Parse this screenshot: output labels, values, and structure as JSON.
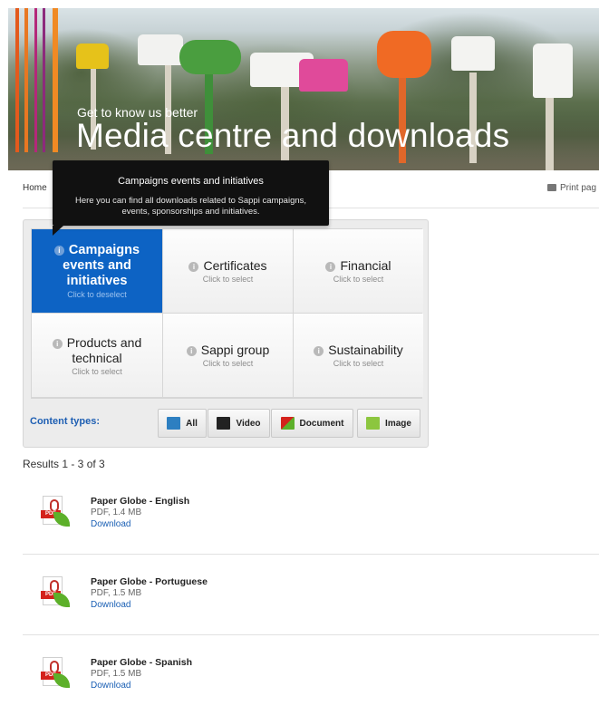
{
  "hero": {
    "subtitle": "Get to know us better",
    "title": "Media centre and downloads"
  },
  "breadcrumb": {
    "home": "Home"
  },
  "print_label": "Print pag",
  "tooltip": {
    "title": "Campaigns events and initiatives",
    "text": "Here you can find all downloads related to Sappi campaigns, events, sponsorships and initiatives."
  },
  "categories": [
    {
      "label": "Campaigns events and initiatives",
      "hint": "Click to deselect",
      "selected": true
    },
    {
      "label": "Certificates",
      "hint": "Click to select",
      "selected": false
    },
    {
      "label": "Financial",
      "hint": "Click to select",
      "selected": false
    },
    {
      "label": "Products and technical",
      "hint": "Click to select",
      "selected": false
    },
    {
      "label": "Sappi group",
      "hint": "Click to select",
      "selected": false
    },
    {
      "label": "Sustainability",
      "hint": "Click to select",
      "selected": false
    }
  ],
  "content_types": {
    "label": "Content types:",
    "buttons": [
      {
        "label": "All",
        "icon": "all-icon"
      },
      {
        "label": "Video",
        "icon": "film-icon"
      },
      {
        "label": "Document",
        "icon": "document-icon"
      },
      {
        "label": "Image",
        "icon": "image-icon"
      }
    ]
  },
  "results": {
    "summary": "Results 1 - 3 of 3",
    "items": [
      {
        "name": "Paper Globe - English",
        "meta": "PDF, 1.4 MB",
        "download": "Download",
        "icon": "pdf-icon"
      },
      {
        "name": "Paper Globe - Portuguese",
        "meta": "PDF, 1.5 MB",
        "download": "Download",
        "icon": "pdf-icon"
      },
      {
        "name": "Paper Globe - Spanish",
        "meta": "PDF, 1.5 MB",
        "download": "Download",
        "icon": "pdf-icon"
      }
    ]
  },
  "colors": {
    "accent": "#0d63c4",
    "link": "#1a5fb4"
  }
}
